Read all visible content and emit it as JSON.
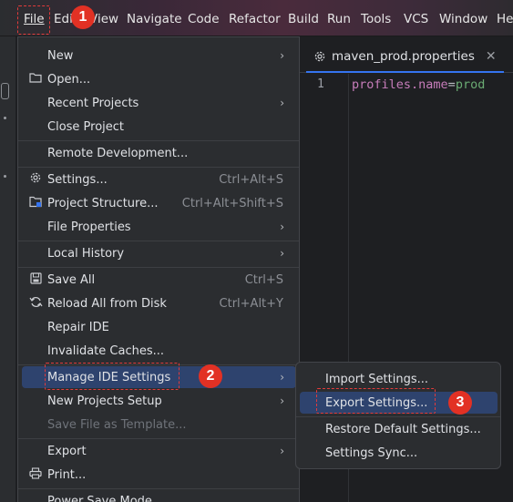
{
  "menubar": {
    "items": [
      "File",
      "Edit",
      "View",
      "Navigate",
      "Code",
      "Refactor",
      "Build",
      "Run",
      "Tools",
      "VCS",
      "Window",
      "Help"
    ]
  },
  "editor": {
    "tab_title": "maven_prod.properties",
    "line_number": "1",
    "code_key": "profiles.name",
    "code_eq": "=",
    "code_value": "prod"
  },
  "file_menu": {
    "new": "New",
    "open": "Open...",
    "recent": "Recent Projects",
    "close": "Close Project",
    "remote": "Remote Development...",
    "settings": "Settings...",
    "settings_sc": "Ctrl+Alt+S",
    "project_structure": "Project Structure...",
    "project_structure_sc": "Ctrl+Alt+Shift+S",
    "file_properties": "File Properties",
    "local_history": "Local History",
    "save_all": "Save All",
    "save_all_sc": "Ctrl+S",
    "reload": "Reload All from Disk",
    "reload_sc": "Ctrl+Alt+Y",
    "repair": "Repair IDE",
    "invalidate": "Invalidate Caches...",
    "manage_ide": "Manage IDE Settings",
    "new_projects_setup": "New Projects Setup",
    "save_template": "Save File as Template...",
    "export": "Export",
    "print": "Print...",
    "power_save": "Power Save Mode"
  },
  "submenu": {
    "import": "Import Settings...",
    "export": "Export Settings...",
    "restore": "Restore Default Settings...",
    "sync": "Settings Sync..."
  },
  "annotations": {
    "step1": "1",
    "step2": "2",
    "step3": "3"
  },
  "colors": {
    "selection": "#2e436e",
    "annotation": "#e23124"
  }
}
